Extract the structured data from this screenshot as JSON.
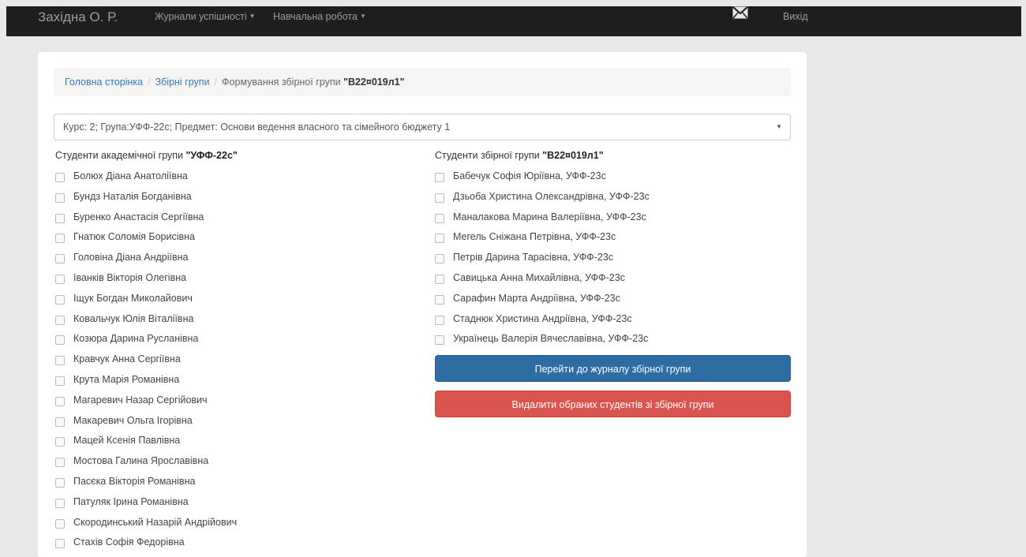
{
  "navbar": {
    "brand": "Західна О. Р.",
    "menu1": "Журнали успішності",
    "menu2": "Навчальна робота",
    "mail_icon": "envelope-icon",
    "exit": "Вихід"
  },
  "breadcrumb": {
    "home": "Головна сторінка",
    "groups": "Збірні групи",
    "current_prefix": "Формування збірної групи ",
    "current_name": "\"В22¤019л1\""
  },
  "course_select": {
    "value": "Курс: 2; Група:УФФ-22с; Предмет: Основи ведення власного та сімейного бюджету 1"
  },
  "left_list": {
    "title_prefix": "Студенти академічної групи ",
    "title_group": "\"УФФ-22с\"",
    "students": [
      "Болюх Діана Анатоліївна",
      "Бундз Наталія Богданівна",
      "Буренко Анастасія Сергіївна",
      "Гнатюк Соломія Борисівна",
      "Головіна Діана Андріївна",
      "Іванків Вікторія Олегівна",
      "Іщук Богдан Миколайович",
      "Ковальчук Юлія Віталіївна",
      "Козюра Дарина Русланівна",
      "Кравчук Анна Сергіївна",
      "Крута Марія Романівна",
      "Магаревич Назар Сергійович",
      "Макаревич Ольга Ігорівна",
      "Мацей Ксенія Павлівна",
      "Мостова Галина Ярославівна",
      "Пасєка Вікторія Романівна",
      "Патуляк Ірина Романівна",
      "Скородинський Назарій Андрійович",
      "Стахів Софія Федорівна"
    ]
  },
  "right_list": {
    "title_prefix": "Студенти збірної групи ",
    "title_group": "\"В22¤019л1\"",
    "students": [
      "Бабечук Софія Юріївна, УФФ-23с",
      "Дзьоба Христина Олександрівна, УФФ-23с",
      "Маналакова Марина Валеріївна, УФФ-23с",
      "Мегель Сніжана Петрівна, УФФ-23с",
      "Петрів Дарина Тарасівна, УФФ-23с",
      "Савицька Анна Михайлівна, УФФ-23с",
      "Сарафин Марта Андріївна, УФФ-23с",
      "Стаднюк Христина Андріївна, УФФ-23с",
      "Українець Валерія Вячеславівна, УФФ-23с"
    ]
  },
  "buttons": {
    "goto_journal": "Перейти до журналу збірної групи",
    "remove_selected": "Видалити обраних студентів зі збірної групи"
  },
  "colors": {
    "primary": "#2e6da4",
    "danger": "#d9534f",
    "navbar": "#1e1e1e"
  }
}
